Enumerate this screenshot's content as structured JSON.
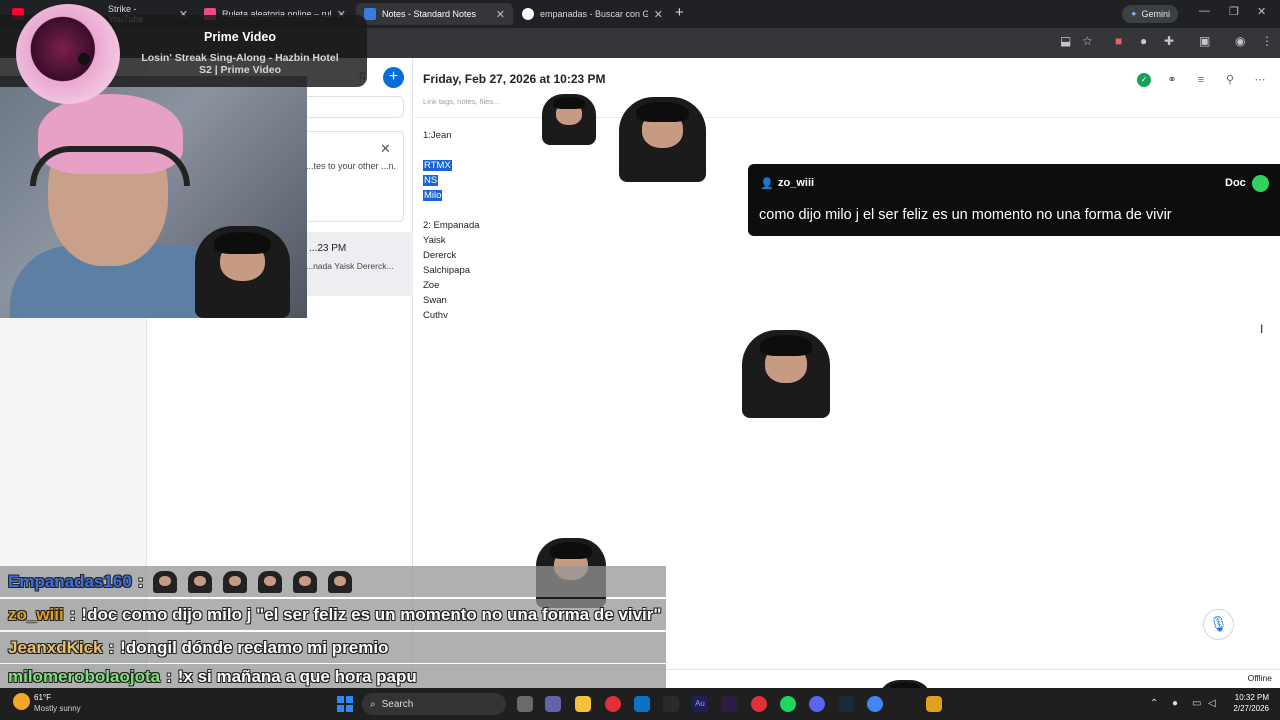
{
  "browser": {
    "tabs": [
      {
        "title": "Strike - YouTube",
        "favicon_color": "#ff0033",
        "active": false
      },
      {
        "title": "Ruleta aleatoria online – ruleta",
        "favicon_color": "#e94b8a",
        "active": false
      },
      {
        "title": "Notes - Standard Notes",
        "favicon_color": "#3a7be0",
        "active": true
      },
      {
        "title": "empanadas - Buscar con Google",
        "favicon_color": "#ffffff",
        "active": false
      }
    ],
    "gemini_label": "Gemini",
    "new_tab": "+",
    "close_glyph": "✕"
  },
  "notes": {
    "list": {
      "card_text": "...tes to your other ...n.",
      "item_time": "...23 PM",
      "item_preview": "...nada Yaisk Dererck..."
    },
    "editor": {
      "title": "Friday, Feb 27, 2026 at 10:23 PM",
      "tags_placeholder": "Link tags, notes, files...",
      "lines": [
        "1:Jean",
        "",
        "RTMX",
        "NS",
        "Milo",
        "",
        "2: Empanada",
        "Yaisk",
        "Dererck",
        "Salchipapa",
        "Zoe",
        "Swan",
        "Cuthv"
      ],
      "selected_lines": [
        "RTMX",
        "NS",
        "Milo"
      ]
    },
    "status": "Offline"
  },
  "prime_video": {
    "title": "Prime Video",
    "subtitle": "Losin' Streak Sing-Along - Hazbin Hotel S2 | Prime Video"
  },
  "alert": {
    "user": "zo_wiii",
    "badge": "Doc",
    "message": "como dijo milo j el ser feliz es un momento no una forma de vivir"
  },
  "chat": [
    {
      "user": "Empanadas160",
      "color": "#3b6fe0",
      "sep": ":",
      "text": "",
      "emotes": 6
    },
    {
      "user": "zo_wiii",
      "color": "#e0a020",
      "sep": ":",
      "text": "!doc como dijo milo j \"el ser feliz es un momento no una forma de vivir\"",
      "emotes": 0
    },
    {
      "user": "JeanxdKick",
      "color": "#e8c070",
      "sep": ":",
      "text": "!dongil dónde reclamo mi premio",
      "emotes": 0
    },
    {
      "user": "milomerobolaojota",
      "color": "#7ee07a",
      "sep": ":",
      "text": "!x si mañana a que hora papu",
      "emotes": 0
    }
  ],
  "taskbar": {
    "temp": "61°F",
    "weather": "Mostly sunny",
    "search": "Search",
    "time": "10:32 PM",
    "date": "2/27/2026"
  }
}
